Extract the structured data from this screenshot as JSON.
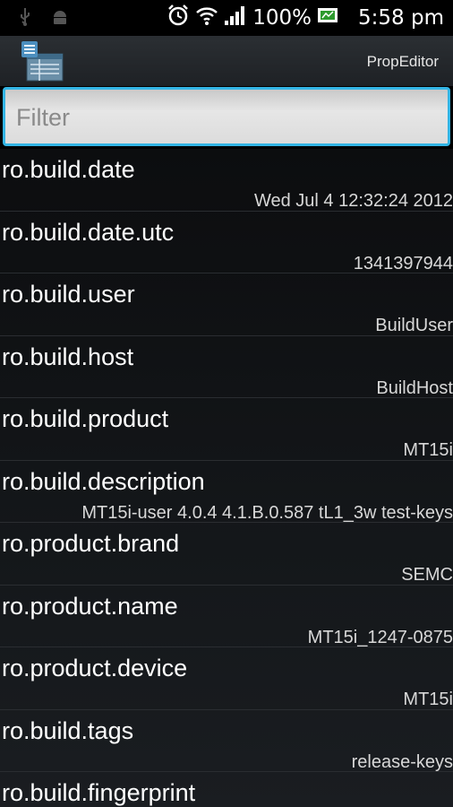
{
  "status_bar": {
    "battery": "100%",
    "time": "5:58 pm"
  },
  "action_bar": {
    "title": "PropEditor"
  },
  "filter": {
    "placeholder": "Filter",
    "value": ""
  },
  "properties": [
    {
      "key": "ro.build.date",
      "value": "Wed Jul 4 12:32:24 2012"
    },
    {
      "key": "ro.build.date.utc",
      "value": "1341397944"
    },
    {
      "key": "ro.build.user",
      "value": "BuildUser"
    },
    {
      "key": "ro.build.host",
      "value": "BuildHost"
    },
    {
      "key": "ro.build.product",
      "value": "MT15i"
    },
    {
      "key": "ro.build.description",
      "value": "MT15i-user 4.0.4 4.1.B.0.587 tL1_3w test-keys"
    },
    {
      "key": "ro.product.brand",
      "value": "SEMC"
    },
    {
      "key": "ro.product.name",
      "value": "MT15i_1247-0875"
    },
    {
      "key": "ro.product.device",
      "value": "MT15i"
    },
    {
      "key": "ro.build.tags",
      "value": "release-keys"
    },
    {
      "key": "ro.build.fingerprint",
      "value": ""
    }
  ]
}
